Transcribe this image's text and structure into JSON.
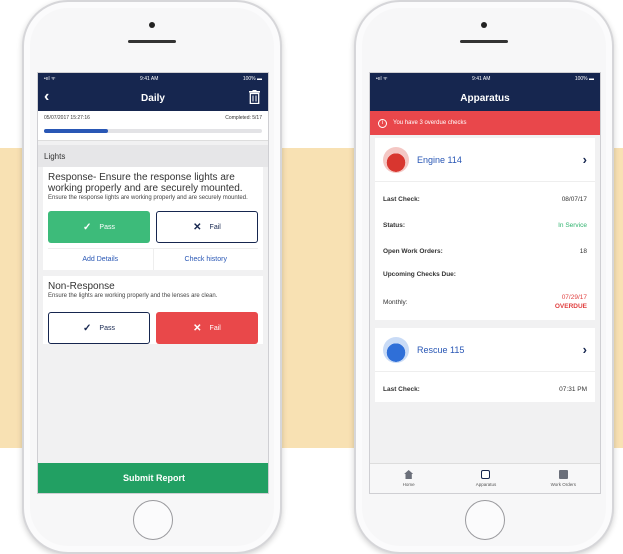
{
  "left_phone": {
    "status": {
      "signal": "•ııl ᯤ",
      "time": "9:41 AM",
      "battery": "100% ▬"
    },
    "nav": {
      "title": "Daily",
      "back_icon": "chevron-left-icon",
      "delete_icon": "trash-icon"
    },
    "progress": {
      "timestamp": "05/07/2017 15:27:16",
      "completed": "Completed: 5/17",
      "fraction": 0.294
    },
    "section": "Lights",
    "items": [
      {
        "title": "Response- Ensure the response lights are working properly and are securely mounted.",
        "subtitle": "Ensure the response lights are working properly and are securely mounted.",
        "pass_label": "Pass",
        "fail_label": "Fail",
        "selected": "pass",
        "add_details": "Add Details",
        "check_history": "Check history"
      },
      {
        "title": "Non-Response",
        "subtitle": "Ensure the lights are working properly and the lenses are clean.",
        "pass_label": "Pass",
        "fail_label": "Fail",
        "selected": "fail"
      }
    ],
    "submit_label": "Submit Report"
  },
  "right_phone": {
    "status": {
      "signal": "•ııl ᯤ",
      "time": "9:41 AM",
      "battery": "100% ▬"
    },
    "nav": {
      "title": "Apparatus"
    },
    "alert": "You have 3 overdue checks",
    "apparatus": [
      {
        "name": "Engine 114",
        "rows": {
          "last_check_label": "Last Check:",
          "last_check_value": "08/07/17",
          "status_label": "Status:",
          "status_value": "In Service",
          "work_orders_label": "Open Work Orders:",
          "work_orders_value": "18",
          "upcoming_label": "Upcoming Checks Due:",
          "monthly_label": "Monthly:",
          "monthly_date": "07/29/17",
          "monthly_flag": "OVERDUE"
        }
      },
      {
        "name": "Rescue 115",
        "rows": {
          "last_check_label": "Last Check:",
          "last_check_value": "07:31 PM"
        }
      }
    ],
    "tabs": [
      {
        "label": "Home",
        "icon": "home-icon"
      },
      {
        "label": "Apparatus",
        "icon": "bus-icon"
      },
      {
        "label": "Work Orders",
        "icon": "clipboard-icon"
      }
    ]
  },
  "colors": {
    "navy": "#16264f",
    "pass_green": "#3dbb7a",
    "fail_red": "#e9484a",
    "submit_green": "#22a063",
    "alert_red": "#e9474b",
    "link_blue": "#2957b5",
    "backdrop": "#f8e1b3"
  }
}
